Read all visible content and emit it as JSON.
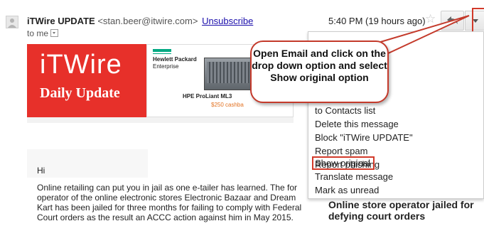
{
  "header": {
    "sender_name": "iTWire UPDATE",
    "sender_email": "<stan.beer@itwire.com>",
    "unsubscribe": "Unsubscribe",
    "to": "to me",
    "time": "5:40 PM (19 hours ago)"
  },
  "banner": {
    "logo": "iTWire",
    "tagline": "Daily Update",
    "ad_brand_line1": "Hewlett Packard",
    "ad_brand_line2": "Enterprise",
    "ad_product": "HPE ProLiant ML3",
    "ad_cashback": "$250 cashba"
  },
  "callout": {
    "text": "Open Email and click on the drop down option and select Show original option"
  },
  "menu": {
    "items": [
      {
        "label": "ns"
      },
      {
        "label": "to Contacts list"
      },
      {
        "label": "Delete this message"
      },
      {
        "label": "Block \"iTWire UPDATE\""
      },
      {
        "label": "Report spam"
      },
      {
        "label": "Report phishing"
      },
      {
        "label": "Show original"
      },
      {
        "label": "Translate message"
      },
      {
        "label": "Mark as unread"
      }
    ]
  },
  "body": {
    "greeting": "Hi",
    "paragraph": "Online retailing can put you in jail as one e-tailer has learned. The for operator of the online electronic stores Electronic Bazaar and Dream Kart has been jailed for three months for failing to comply with Federal Court orders as the result an ACCC action against him in May 2015.",
    "sidebar_headline": "Online store operator jailed for defying court orders"
  },
  "colors": {
    "itwire_red": "#e7302a",
    "highlight_red": "#d23a2a",
    "hpe_green": "#01a982"
  }
}
